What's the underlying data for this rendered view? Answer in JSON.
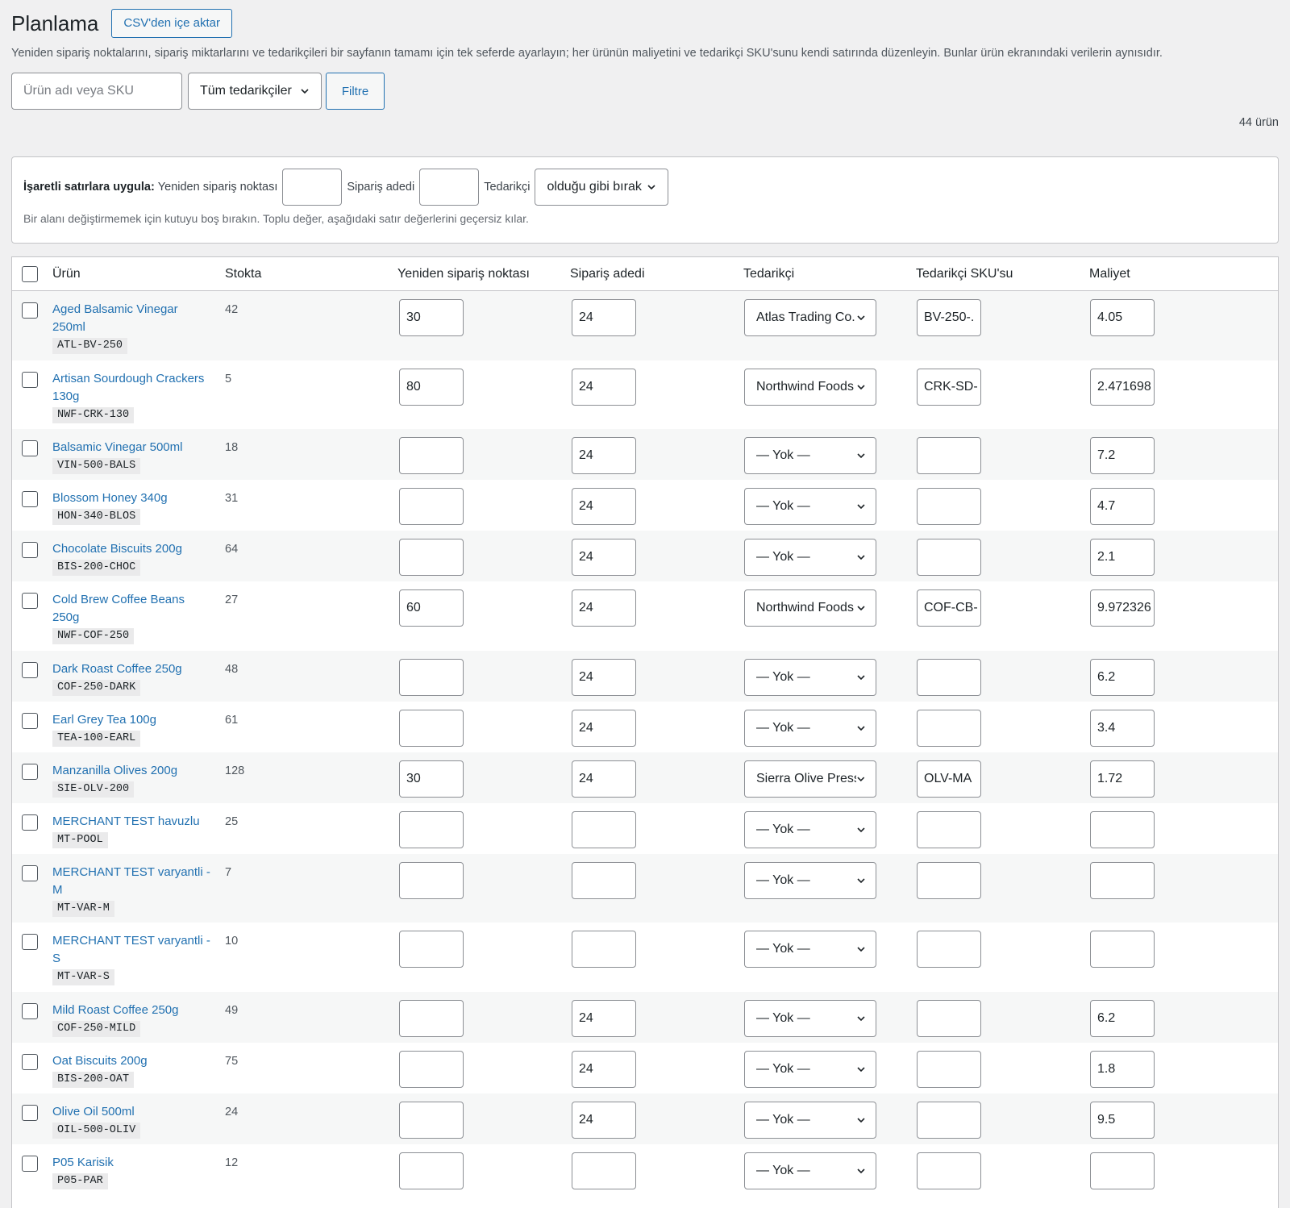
{
  "header": {
    "title": "Planlama",
    "import_button": "CSV'den içe aktar",
    "description": "Yeniden sipariş noktalarını, sipariş miktarlarını ve tedarikçileri bir sayfanın tamamı için tek seferde ayarlayın; her ürünün maliyetini ve tedarikçi SKU'sunu kendi satırında düzenleyin. Bunlar ürün ekranındaki verilerin aynısıdır."
  },
  "filters": {
    "search_placeholder": "Ürün adı veya SKU",
    "supplier_select": "Tüm tedarikçiler",
    "filter_button": "Filtre",
    "count": "44 ürün"
  },
  "bulk": {
    "label": "İşaretli satırlara uygula:",
    "reorder_label": "Yeniden sipariş noktası",
    "qty_label": "Sipariş adedi",
    "supplier_label": "Tedarikçi",
    "supplier_value": "olduğu gibi bırak",
    "hint": "Bir alanı değiştirmemek için kutuyu boş bırakın. Toplu değer, aşağıdaki satır değerlerini geçersiz kılar."
  },
  "table": {
    "columns": {
      "product": "Ürün",
      "stock": "Stokta",
      "reorder": "Yeniden sipariş noktası",
      "qty": "Sipariş adedi",
      "supplier": "Tedarikçi",
      "supplier_sku": "Tedarikçi SKU'su",
      "cost": "Maliyet"
    },
    "rows": [
      {
        "name": "Aged Balsamic Vinegar 250ml",
        "sku": "ATL-BV-250",
        "stock": "42",
        "reorder": "30",
        "qty": "24",
        "supplier": "Atlas Trading Co.",
        "supplier_sku": "BV-250-.",
        "cost": "4.05"
      },
      {
        "name": "Artisan Sourdough Crackers 130g",
        "sku": "NWF-CRK-130",
        "stock": "5",
        "reorder": "80",
        "qty": "24",
        "supplier": "Northwind Foods",
        "supplier_sku": "CRK-SD-",
        "cost": "2.471698"
      },
      {
        "name": "Balsamic Vinegar 500ml",
        "sku": "VIN-500-BALS",
        "stock": "18",
        "reorder": "",
        "qty": "24",
        "supplier": "— Yok —",
        "supplier_sku": "",
        "cost": "7.2"
      },
      {
        "name": "Blossom Honey 340g",
        "sku": "HON-340-BLOS",
        "stock": "31",
        "reorder": "",
        "qty": "24",
        "supplier": "— Yok —",
        "supplier_sku": "",
        "cost": "4.7"
      },
      {
        "name": "Chocolate Biscuits 200g",
        "sku": "BIS-200-CHOC",
        "stock": "64",
        "reorder": "",
        "qty": "24",
        "supplier": "— Yok —",
        "supplier_sku": "",
        "cost": "2.1"
      },
      {
        "name": "Cold Brew Coffee Beans 250g",
        "sku": "NWF-COF-250",
        "stock": "27",
        "reorder": "60",
        "qty": "24",
        "supplier": "Northwind Foods",
        "supplier_sku": "COF-CB-",
        "cost": "9.972326"
      },
      {
        "name": "Dark Roast Coffee 250g",
        "sku": "COF-250-DARK",
        "stock": "48",
        "reorder": "",
        "qty": "24",
        "supplier": "— Yok —",
        "supplier_sku": "",
        "cost": "6.2"
      },
      {
        "name": "Earl Grey Tea 100g",
        "sku": "TEA-100-EARL",
        "stock": "61",
        "reorder": "",
        "qty": "24",
        "supplier": "— Yok —",
        "supplier_sku": "",
        "cost": "3.4"
      },
      {
        "name": "Manzanilla Olives 200g",
        "sku": "SIE-OLV-200",
        "stock": "128",
        "reorder": "30",
        "qty": "24",
        "supplier": "Sierra Olive Press",
        "supplier_sku": "OLV-MA",
        "cost": "1.72"
      },
      {
        "name": "MERCHANT TEST havuzlu",
        "sku": "MT-POOL",
        "stock": "25",
        "reorder": "",
        "qty": "",
        "supplier": "— Yok —",
        "supplier_sku": "",
        "cost": ""
      },
      {
        "name": "MERCHANT TEST varyantli - M",
        "sku": "MT-VAR-M",
        "stock": "7",
        "reorder": "",
        "qty": "",
        "supplier": "— Yok —",
        "supplier_sku": "",
        "cost": ""
      },
      {
        "name": "MERCHANT TEST varyantli - S",
        "sku": "MT-VAR-S",
        "stock": "10",
        "reorder": "",
        "qty": "",
        "supplier": "— Yok —",
        "supplier_sku": "",
        "cost": ""
      },
      {
        "name": "Mild Roast Coffee 250g",
        "sku": "COF-250-MILD",
        "stock": "49",
        "reorder": "",
        "qty": "24",
        "supplier": "— Yok —",
        "supplier_sku": "",
        "cost": "6.2"
      },
      {
        "name": "Oat Biscuits 200g",
        "sku": "BIS-200-OAT",
        "stock": "75",
        "reorder": "",
        "qty": "24",
        "supplier": "— Yok —",
        "supplier_sku": "",
        "cost": "1.8"
      },
      {
        "name": "Olive Oil 500ml",
        "sku": "OIL-500-OLIV",
        "stock": "24",
        "reorder": "",
        "qty": "24",
        "supplier": "— Yok —",
        "supplier_sku": "",
        "cost": "9.5"
      },
      {
        "name": "P05 Karisik",
        "sku": "P05-PAR",
        "stock": "12",
        "reorder": "",
        "qty": "",
        "supplier": "— Yok —",
        "supplier_sku": "",
        "cost": ""
      }
    ]
  },
  "colors": {
    "background": "#f0f0f1",
    "accent": "#2271b1",
    "row_alt": "#f6f7f7"
  }
}
